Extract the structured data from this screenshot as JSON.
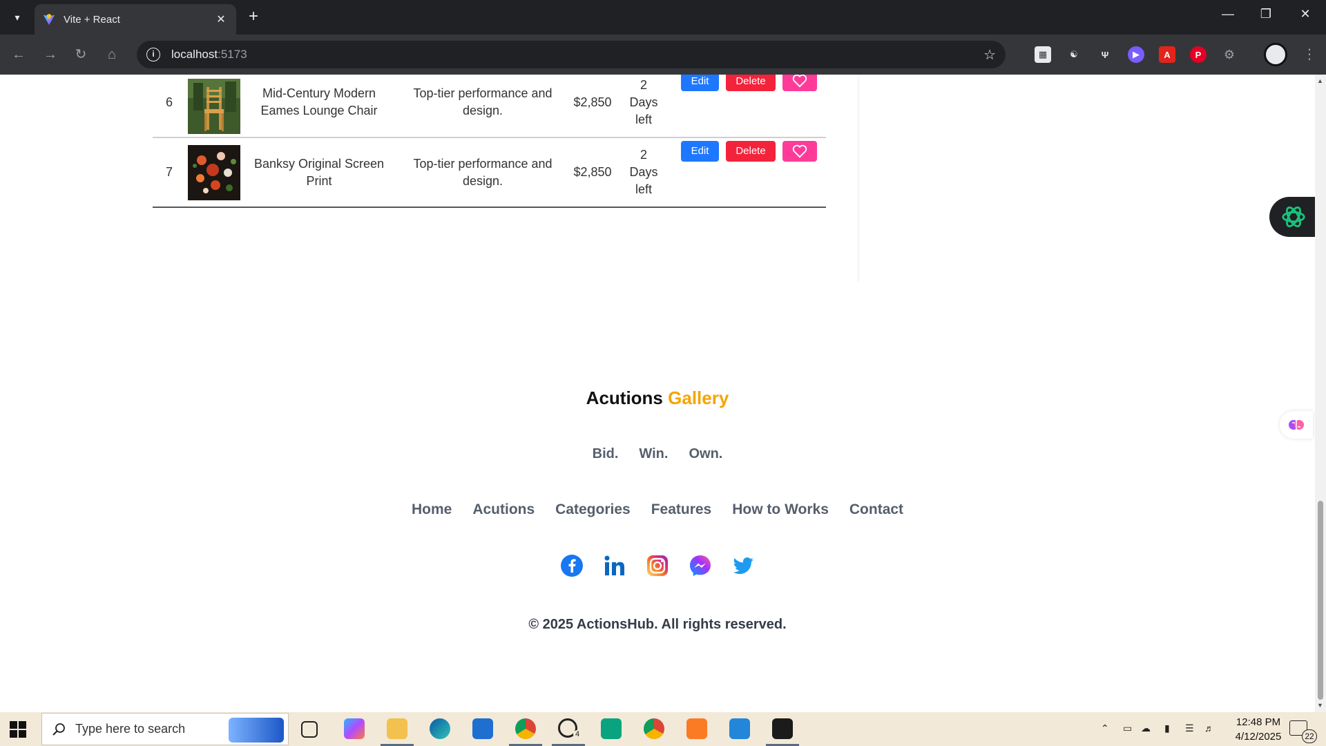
{
  "browser": {
    "tab_title": "Vite + React",
    "url_host": "localhost",
    "url_port": ":5173"
  },
  "table": {
    "rows": [
      {
        "index": "6",
        "title": "Mid-Century Modern Eames Lounge Chair",
        "description": "Top-tier performance and design.",
        "price": "$2,850",
        "time_left": "2 Days left",
        "edit_label": "Edit",
        "delete_label": "Delete"
      },
      {
        "index": "7",
        "title": "Banksy Original Screen Print",
        "description": "Top-tier performance and design.",
        "price": "$2,850",
        "time_left": "2 Days left",
        "edit_label": "Edit",
        "delete_label": "Delete"
      }
    ]
  },
  "footer": {
    "brand_main": "Acutions",
    "brand_accent": "Gallery",
    "tagline": [
      "Bid.",
      "Win.",
      "Own."
    ],
    "nav": [
      "Home",
      "Acutions",
      "Categories",
      "Features",
      "How to Works",
      "Contact"
    ],
    "social": [
      "facebook-icon",
      "linkedin-icon",
      "instagram-icon",
      "messenger-icon",
      "twitter-icon"
    ],
    "copyright": "© 2025 ActionsHub. All rights reserved."
  },
  "taskbar": {
    "search_placeholder": "Type here to search",
    "whatsapp_badge": "4",
    "time": "12:48 PM",
    "date": "4/12/2025",
    "notification_count": "22"
  },
  "colors": {
    "brand_accent": "#f5a400",
    "edit": "#1e78ff",
    "delete": "#f3233b",
    "favorite": "#ff3b9a"
  }
}
